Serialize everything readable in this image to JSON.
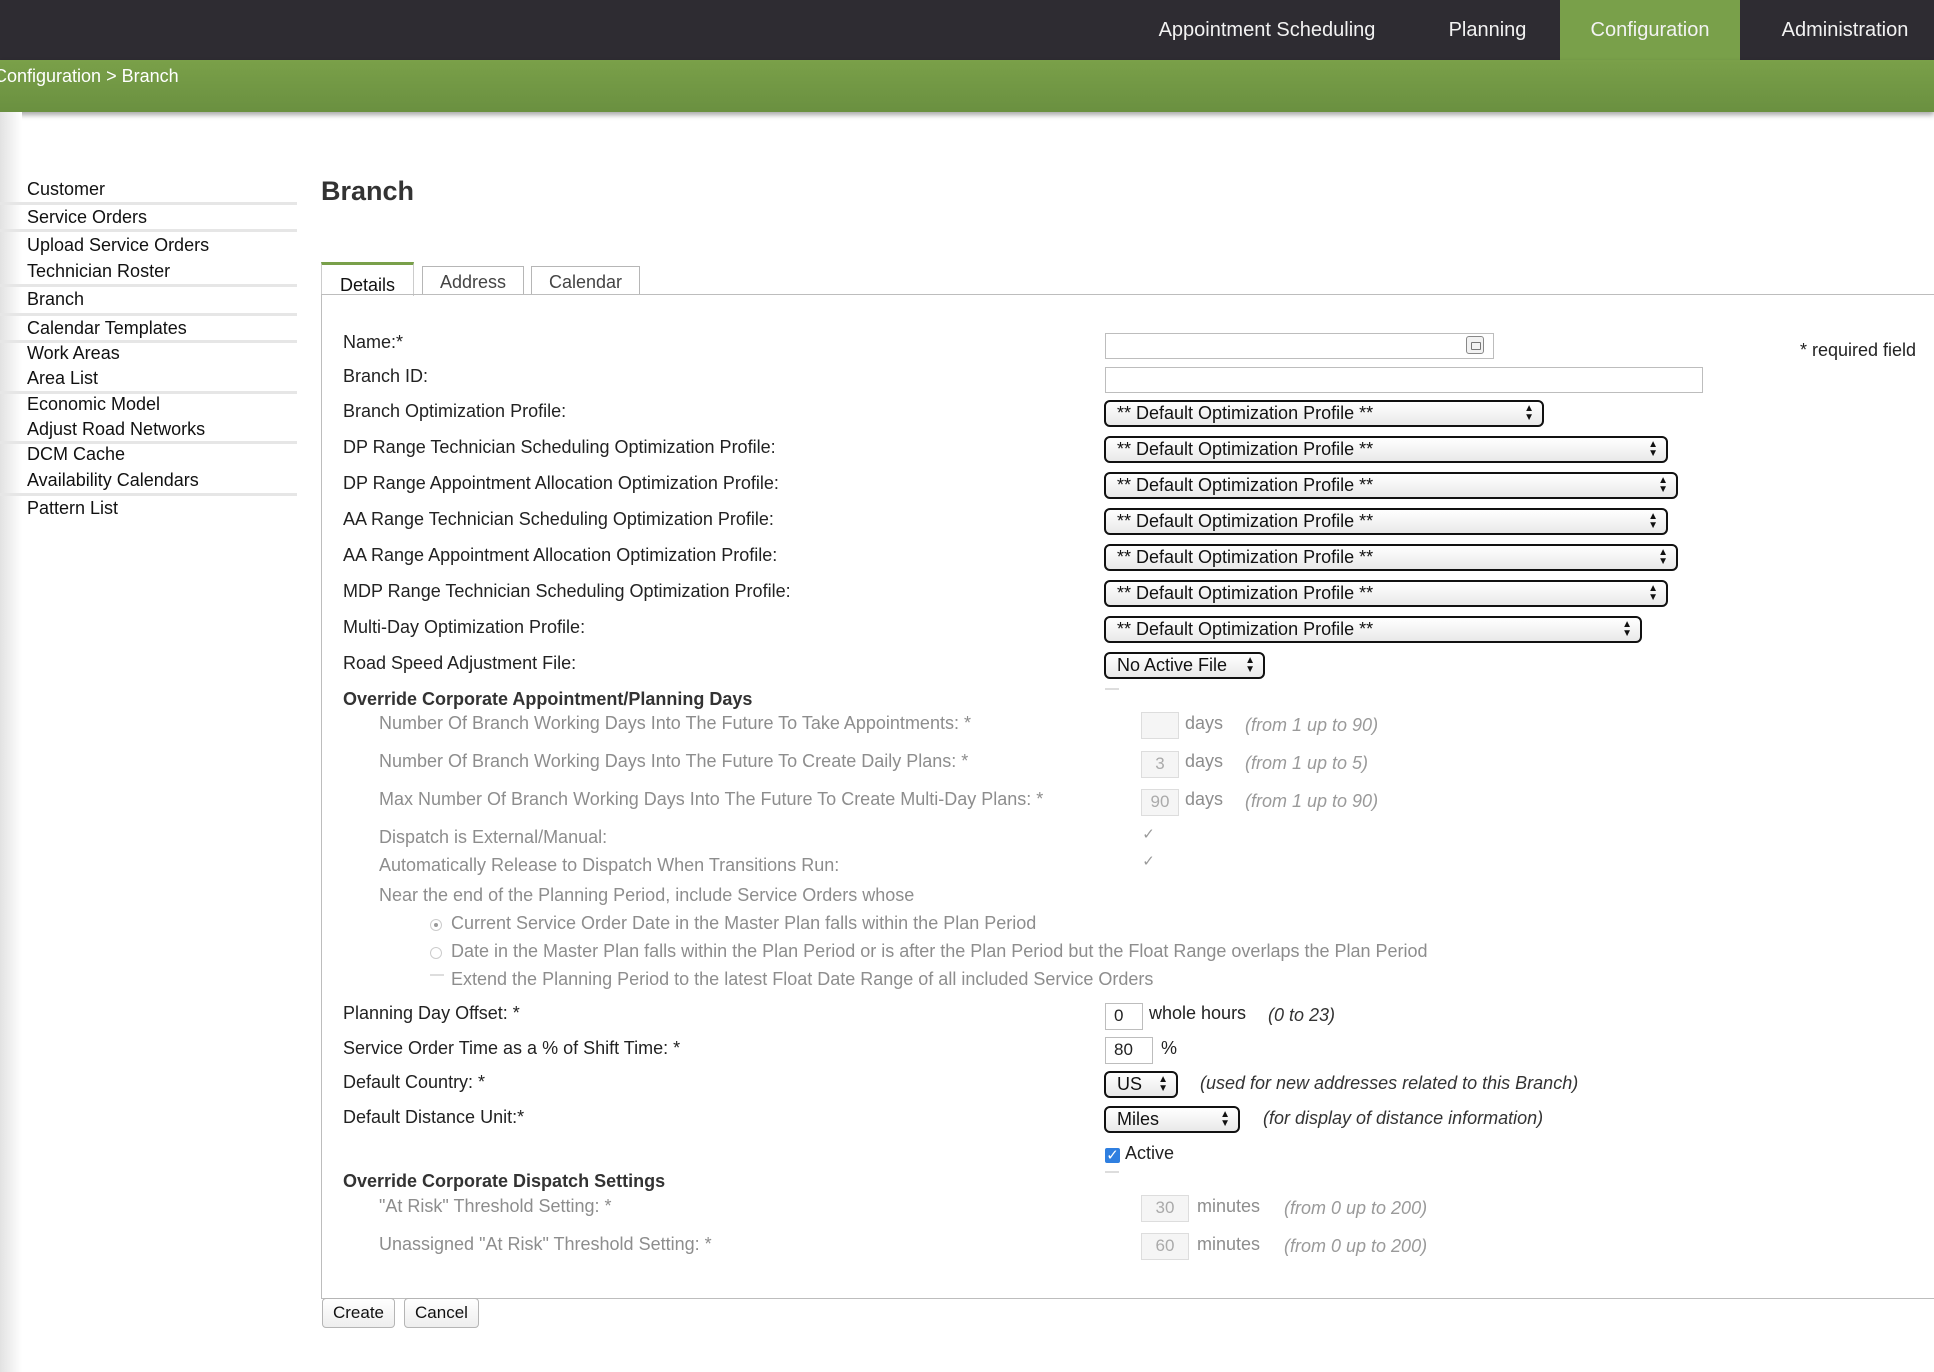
{
  "topnav": {
    "tabs": [
      {
        "label": "Appointment Scheduling"
      },
      {
        "label": "Planning"
      },
      {
        "label": "Configuration"
      },
      {
        "label": "Administration"
      }
    ]
  },
  "breadcrumb": {
    "parent": "Configuration",
    "sep": ">",
    "current": "Branch"
  },
  "sidebar": {
    "items": [
      {
        "label": "Customer"
      },
      {
        "label": "Service Orders"
      },
      {
        "label": "Upload Service Orders"
      },
      {
        "label": "Technician Roster"
      },
      {
        "label": "Branch"
      },
      {
        "label": "Calendar Templates"
      },
      {
        "label": "Work Areas"
      },
      {
        "label": "Area List"
      },
      {
        "label": "Economic Model"
      },
      {
        "label": "Adjust Road Networks"
      },
      {
        "label": "DCM Cache"
      },
      {
        "label": "Availability Calendars"
      },
      {
        "label": "Pattern List"
      }
    ]
  },
  "page": {
    "title": "Branch"
  },
  "tabs": [
    {
      "label": "Details"
    },
    {
      "label": "Address"
    },
    {
      "label": "Calendar"
    }
  ],
  "form": {
    "required_note": "* required field",
    "name_label": "Name:*",
    "name_value": "",
    "branch_id_label": "Branch ID:",
    "branch_id_value": "",
    "profiles": [
      {
        "label": "Branch Optimization Profile:",
        "value": "** Default Optimization Profile **"
      },
      {
        "label": "DP Range Technician Scheduling Optimization Profile:",
        "value": "** Default Optimization Profile **"
      },
      {
        "label": "DP Range Appointment Allocation Optimization Profile:",
        "value": "** Default Optimization Profile **"
      },
      {
        "label": "AA Range Technician Scheduling Optimization Profile:",
        "value": "** Default Optimization Profile **"
      },
      {
        "label": "AA Range Appointment Allocation Optimization Profile:",
        "value": "** Default Optimization Profile **"
      },
      {
        "label": "MDP Range Technician Scheduling Optimization Profile:",
        "value": "** Default Optimization Profile **"
      },
      {
        "label": "Multi-Day Optimization Profile:",
        "value": "** Default Optimization Profile **"
      }
    ],
    "road_speed_label": "Road Speed Adjustment File:",
    "road_speed_value": "No Active File",
    "override_planning": {
      "header": "Override Corporate Appointment/Planning Days",
      "appt_days_label": "Number Of Branch Working Days Into The Future To Take Appointments: *",
      "appt_days_value": "",
      "appt_days_unit": "days",
      "appt_days_note": "(from 1 up to 90)",
      "daily_plans_label": "Number Of Branch Working Days Into The Future To Create Daily Plans: *",
      "daily_plans_value": "3",
      "daily_plans_unit": "days",
      "daily_plans_note": "(from 1 up to 5)",
      "multi_day_label": "Max Number Of Branch Working Days Into The Future To Create Multi-Day Plans: *",
      "multi_day_value": "90",
      "multi_day_unit": "days",
      "multi_day_note": "(from 1 up to 90)",
      "dispatch_external_label": "Dispatch is External/Manual:",
      "auto_release_label": "Automatically Release to Dispatch When Transitions Run:",
      "near_end_label": "Near the end of the Planning Period, include Service Orders whose",
      "radio_options": [
        {
          "label": "Current Service Order Date in the Master Plan falls within the Plan Period"
        },
        {
          "label": "Date in the Master Plan falls within the Plan Period or is after the Plan Period but the Float Range overlaps the Plan Period"
        }
      ],
      "extend_label": "Extend the Planning Period to the latest Float Date Range of all included Service Orders"
    },
    "planning_day_offset_label": "Planning Day Offset: *",
    "planning_day_offset_value": "0",
    "planning_day_offset_unit": "whole hours",
    "planning_day_offset_note": "(0 to 23)",
    "so_time_label": "Service Order Time as a % of Shift Time: *",
    "so_time_value": "80",
    "so_time_unit": "%",
    "country_label": "Default Country: *",
    "country_value": "US",
    "country_note": "(used for new addresses related to this Branch)",
    "distance_label": "Default Distance Unit:*",
    "distance_value": "Miles",
    "distance_note": "(for display of distance information)",
    "active_label": "Active",
    "override_dispatch": {
      "header": "Override Corporate Dispatch Settings",
      "at_risk_label": "\"At Risk\" Threshold Setting: *",
      "at_risk_value": "30",
      "at_risk_unit": "minutes",
      "at_risk_note": "(from 0 up to 200)",
      "unassigned_label": "Unassigned \"At Risk\" Threshold Setting: *",
      "unassigned_value": "60",
      "unassigned_unit": "minutes",
      "unassigned_note": "(from 0 up to 200)"
    }
  },
  "buttons": {
    "create": "Create",
    "cancel": "Cancel"
  },
  "colors": {
    "nav_bg": "#2e2c32",
    "accent_green": "#79a04a",
    "checkbox_blue": "#2f7fe0"
  }
}
